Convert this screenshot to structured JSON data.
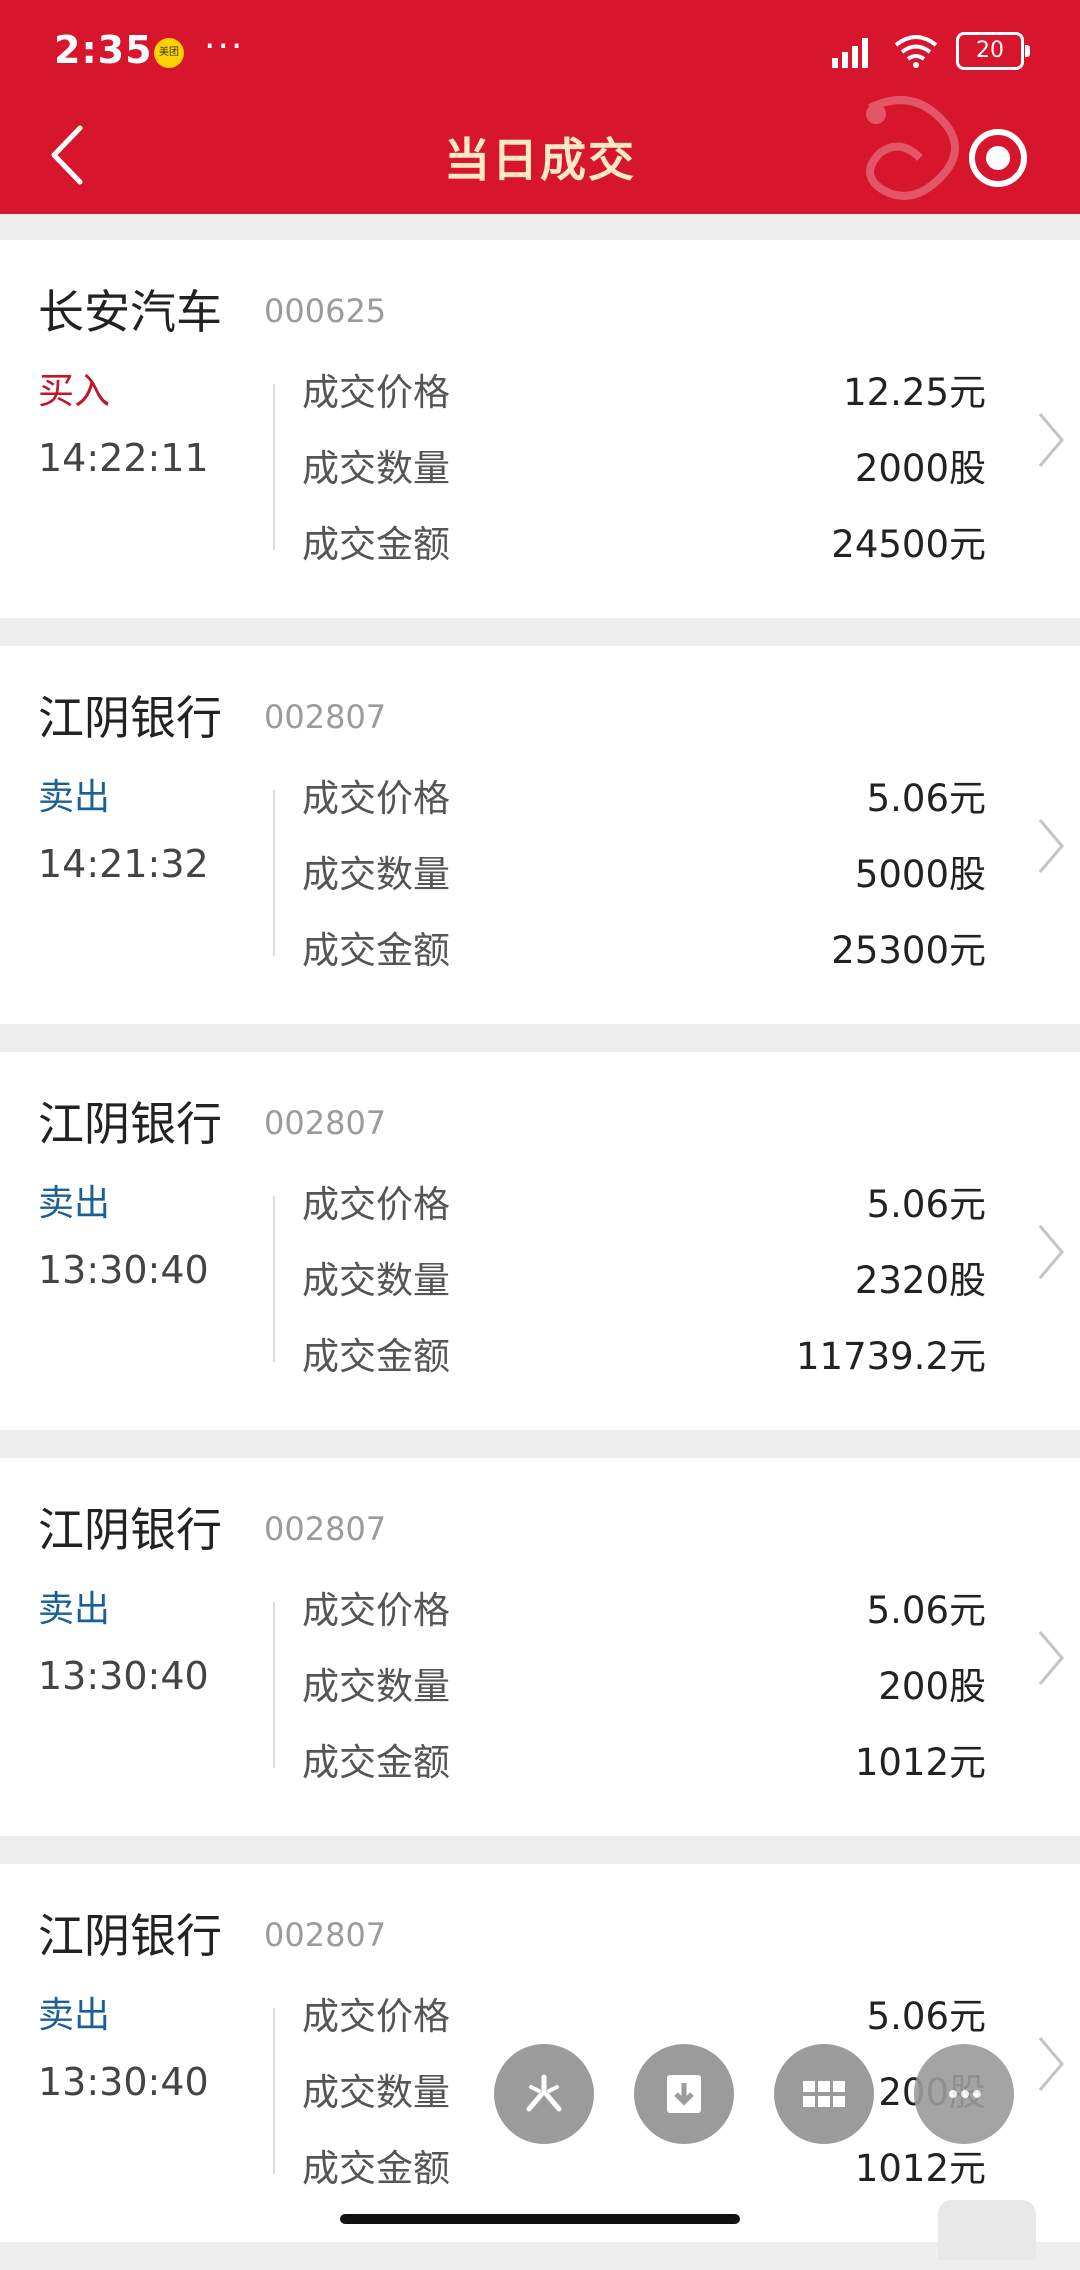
{
  "status_bar": {
    "time": "2:35",
    "app_badge": "美团",
    "more": "···",
    "battery": "20"
  },
  "header": {
    "title": "当日成交"
  },
  "trades": [
    {
      "name": "长安汽车",
      "code": "000625",
      "direction": "买入",
      "direction_type": "buy",
      "time": "14:22:11",
      "price_label": "成交价格",
      "price": "12.25元",
      "qty_label": "成交数量",
      "qty": "2000股",
      "amount_label": "成交金额",
      "amount": "24500元"
    },
    {
      "name": "江阴银行",
      "code": "002807",
      "direction": "卖出",
      "direction_type": "sell",
      "time": "14:21:32",
      "price_label": "成交价格",
      "price": "5.06元",
      "qty_label": "成交数量",
      "qty": "5000股",
      "amount_label": "成交金额",
      "amount": "25300元"
    },
    {
      "name": "江阴银行",
      "code": "002807",
      "direction": "卖出",
      "direction_type": "sell",
      "time": "13:30:40",
      "price_label": "成交价格",
      "price": "5.06元",
      "qty_label": "成交数量",
      "qty": "2320股",
      "amount_label": "成交金额",
      "amount": "11739.2元"
    },
    {
      "name": "江阴银行",
      "code": "002807",
      "direction": "卖出",
      "direction_type": "sell",
      "time": "13:30:40",
      "price_label": "成交价格",
      "price": "5.06元",
      "qty_label": "成交数量",
      "qty": "200股",
      "amount_label": "成交金额",
      "amount": "1012元"
    },
    {
      "name": "江阴银行",
      "code": "002807",
      "direction": "卖出",
      "direction_type": "sell",
      "time": "13:30:40",
      "price_label": "成交价格",
      "price": "5.06元",
      "qty_label": "成交数量",
      "qty": "200股",
      "amount_label": "成交金额",
      "amount": "1012元"
    }
  ],
  "floating_buttons": [
    "sparkle-icon",
    "download-icon",
    "grid-icon",
    "more-icon"
  ],
  "colors": {
    "brand_red": "#d7152c",
    "buy": "#c0152a",
    "sell": "#1a5f96",
    "title": "#ffe8c8"
  }
}
